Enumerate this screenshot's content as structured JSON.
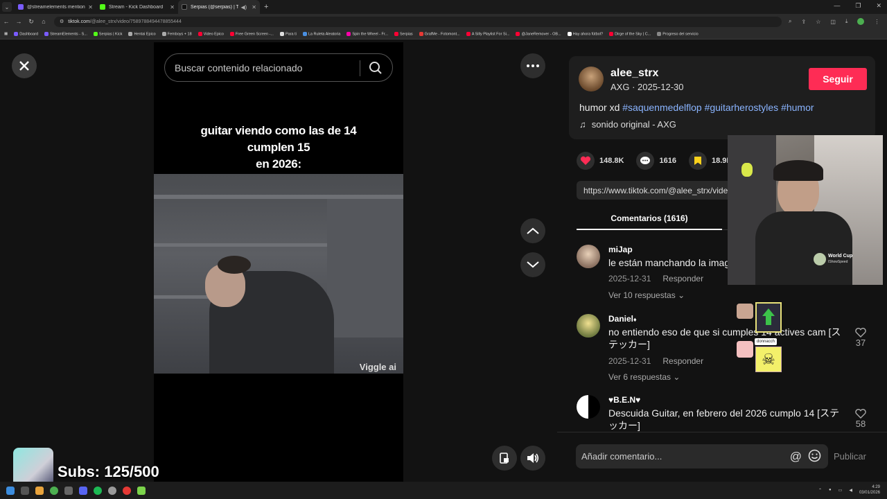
{
  "browser": {
    "tabs": [
      {
        "title": "@streamelements mention",
        "color": "#7a5cff"
      },
      {
        "title": "Stream - Kick Dashboard",
        "color": "#53fc18"
      },
      {
        "title": "Serpias (@serpias) | TikTok",
        "color": "#111111"
      }
    ],
    "url_host": "tiktok.com",
    "url_path": "/@alee_strx/video/7589788494478855444",
    "bookmarks": [
      "Dashboard",
      "StreamElements - S...",
      "Serpias | Kick",
      "Hentai Epico",
      "Femboys + 18",
      "Video Epico",
      "Free Green Screen -...",
      "Para ti",
      "La Ruleta Aleatoria",
      "Spin the Wheel - Fr...",
      "Serpias",
      "GrafMe - Fotomont...",
      "A Silly Playlist For Si...",
      "@JaneRemover - OB...",
      "Hay ahora fútbol?",
      "Dirge of the Sky | C...",
      "Progreso del servicio"
    ]
  },
  "search": {
    "placeholder": "Buscar contenido relacionado"
  },
  "video": {
    "caption_lines": [
      "guitar viendo como las de 14",
      "cumplen 15",
      "en 2026:"
    ],
    "watermark": "Viggle ai"
  },
  "post": {
    "username": "alee_strx",
    "meta": "AXG · 2025-12-30",
    "follow_label": "Seguir",
    "desc_text": "humor xd ",
    "hashtags": [
      "#saquenmedelflop",
      "#guitarherostyles",
      "#humor"
    ],
    "music": "sonido original - AXG",
    "likes": "148.8K",
    "comments": "1616",
    "saves": "18.9K",
    "link": "https://www.tiktok.com/@alee_strx/video/7589788494478855444"
  },
  "comments_tab": "Comentarios (1616)",
  "comments": [
    {
      "user": "miJap",
      "text": "le están manchando la imagen a guitar",
      "date": "2025-12-31",
      "reply": "Responder",
      "more": "Ver 10 respuestas",
      "likes": ""
    },
    {
      "user": "Daniel",
      "text": "no entiendo eso de que si cumples 14 actives cam [ステッカー]",
      "date": "2025-12-31",
      "reply": "Responder",
      "more": "Ver 6 respuestas",
      "likes": "37"
    },
    {
      "user": "B.E.N",
      "text": "Descuida Guitar, en febrero del 2026 cumplo 14 [ステッカー]",
      "date": "",
      "reply": "",
      "more": "",
      "likes": "58"
    }
  ],
  "comment_input": {
    "placeholder": "Añadir comentario...",
    "publish": "Publicar"
  },
  "overlay": {
    "subs": "Subs: 125/500",
    "cam_badge": "World Cup",
    "cam_badge_sub": "IShowSpeed",
    "sticker_label": "donnacch"
  },
  "taskbar": {
    "time": "4:29",
    "date": "03/01/2026"
  },
  "colors": {
    "accent": "#fe2c55",
    "hashtag": "#8ab4ff",
    "bg": "#121212"
  }
}
